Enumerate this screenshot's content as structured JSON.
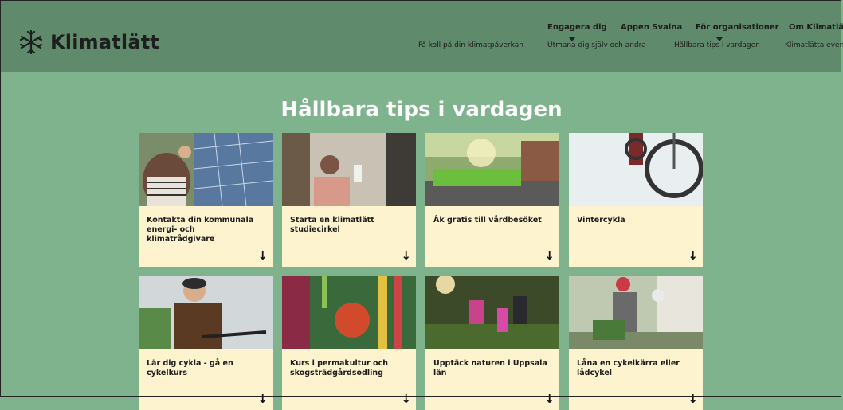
{
  "brand": {
    "name": "Klimatlätt"
  },
  "nav": {
    "top": [
      "Engagera dig",
      "Appen Svalna",
      "För organisationer",
      "Om Klimatlätt"
    ],
    "bottom": [
      "Få koll på din klimatpåverkan",
      "Utmana dig själv och andra",
      "Hållbara tips i vardagen",
      "Klimatlätta event"
    ]
  },
  "page": {
    "title": "Hållbara tips i vardagen"
  },
  "cards": [
    {
      "title": "Kontakta din kommunala energi- och klimatrådgivare"
    },
    {
      "title": "Starta en klimatlätt studiecirkel"
    },
    {
      "title": "Åk gratis till vårdbesöket"
    },
    {
      "title": "Vintercykla"
    },
    {
      "title": "Lär dig cykla - gå en cykelkurs"
    },
    {
      "title": "Kurs i permakultur och skogsträdgårdsodling"
    },
    {
      "title": "Upptäck naturen i Uppsala län"
    },
    {
      "title": "Låna en cykelkärra eller lådcykel"
    }
  ],
  "colors": {
    "header": "#5f8b6c",
    "background": "#7fb38d",
    "card": "#fdf4cf"
  }
}
